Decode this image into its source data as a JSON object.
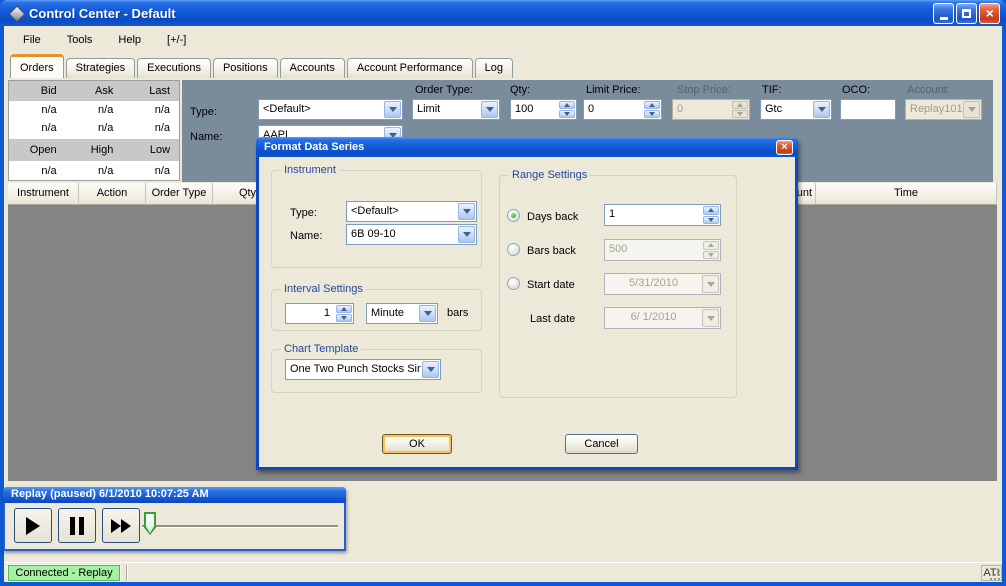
{
  "window": {
    "title": "Control Center - Default"
  },
  "menu": [
    "File",
    "Tools",
    "Help",
    "[+/-]"
  ],
  "tabs": [
    "Orders",
    "Strategies",
    "Executions",
    "Positions",
    "Accounts",
    "Account Performance",
    "Log"
  ],
  "active_tab": "Orders",
  "market_grid": {
    "headers_top": [
      "Bid",
      "Ask",
      "Last"
    ],
    "rows_top": [
      [
        "n/a",
        "n/a",
        "n/a"
      ],
      [
        "n/a",
        "n/a",
        "n/a"
      ]
    ],
    "headers_mid": [
      "Open",
      "High",
      "Low"
    ],
    "row_bottom": [
      "n/a",
      "n/a",
      "n/a"
    ]
  },
  "order_entry": {
    "type_label": "Type:",
    "type_value": "<Default>",
    "name_label": "Name:",
    "name_value": "AAPL",
    "order_type_label": "Order Type:",
    "order_type_value": "Limit",
    "qty_label": "Qty:",
    "qty_value": "100",
    "limit_price_label": "Limit Price:",
    "limit_price_value": "0",
    "stop_price_label": "Stop Price:",
    "stop_price_value": "0",
    "tif_label": "TIF:",
    "tif_value": "Gtc",
    "oco_label": "OCO:",
    "oco_value": "",
    "account_label": "Account:",
    "account_value": "Replay101"
  },
  "orders_table": {
    "columns": [
      "Instrument",
      "Action",
      "Order Type",
      "Qty",
      "Account",
      "Time"
    ]
  },
  "dialog": {
    "title": "Format Data Series",
    "instrument_group": {
      "label": "Instrument",
      "type_label": "Type:",
      "type_value": "<Default>",
      "name_label": "Name:",
      "name_value": "6B 09-10"
    },
    "interval_group": {
      "label": "Interval Settings",
      "value": "1",
      "unit": "Minute",
      "suffix": "bars"
    },
    "template_group": {
      "label": "Chart Template",
      "value": "One Two Punch Stocks Sin"
    },
    "range_group": {
      "label": "Range Settings",
      "days_back_label": "Days back",
      "days_back_value": "1",
      "bars_back_label": "Bars back",
      "bars_back_value": "500",
      "start_date_label": "Start date",
      "start_date_value": "5/31/2010",
      "last_date_label": "Last date",
      "last_date_value": "6/ 1/2010",
      "selected_option": "Days back"
    },
    "ok_label": "OK",
    "cancel_label": "Cancel"
  },
  "replay": {
    "title": "Replay (paused) 6/1/2010 10:07:25 AM"
  },
  "statusbar": {
    "connection": "Connected - Replay",
    "ati": "ATI"
  },
  "colors": {
    "titlebar_blue": "#125CD8",
    "dialog_frame_blue": "#0D47C4",
    "slate_panel": "#7A8B9B",
    "status_green": "#A2F2A2",
    "focus_orange": "#F8C155",
    "group_label_blue": "#26479E",
    "selected_tab_orange": "#E5932B"
  }
}
